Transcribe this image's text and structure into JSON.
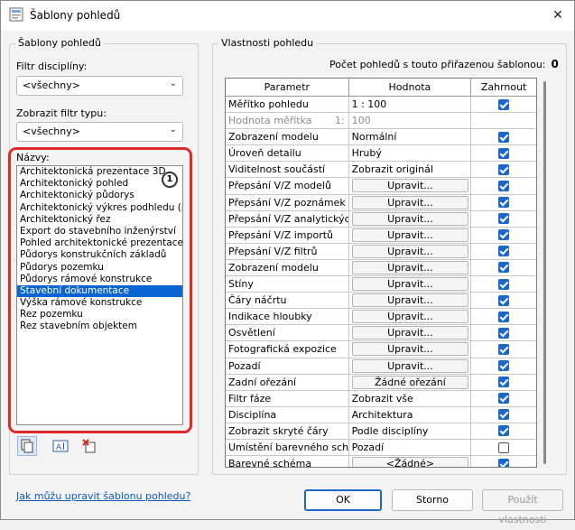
{
  "window": {
    "title": "Šablony pohledů"
  },
  "left_group": {
    "title": "Šablony pohledů",
    "discipline_filter": {
      "label": "Filtr disciplíny:",
      "value": "<všechny>"
    },
    "type_filter": {
      "label": "Zobrazit filtr typu:",
      "value": "<všechny>"
    },
    "names_label": "Názvy:",
    "callout": "1",
    "names": [
      "Architektonická prezentace 3D",
      "Architektonický pohled",
      "Architektonický půdorys",
      "Architektonický výkres podhledu (promítnutý)",
      "Architektonický řez",
      "Export do stavebního inženýrství",
      "Pohled architektonické prezentace",
      "Půdorys konstrukčních základů",
      "Půdorys pozemku",
      "Půdorys rámové konstrukce",
      "Stavební dokumentace",
      "Výška rámové konstrukce",
      "Řez pozemku",
      "Řez stavebním objektem"
    ],
    "selected_index": 10
  },
  "right_group": {
    "title": "Vlastnosti pohledu",
    "count_label": "Počet pohledů s touto přiřazenou šablonou:",
    "count_value": "0",
    "headers": {
      "param": "Parametr",
      "value": "Hodnota",
      "include": "Zahrnout"
    },
    "rows": [
      {
        "param": "Měřítko pohledu",
        "value": "1 : 100",
        "kind": "text",
        "include": true
      },
      {
        "param": "Hodnota měřítka",
        "scale_prefix": "1:",
        "value": "100",
        "kind": "text",
        "include": null,
        "dim": true
      },
      {
        "param": "Zobrazení modelu",
        "value": "Normální",
        "kind": "text",
        "include": true
      },
      {
        "param": "Úroveň detailu",
        "value": "Hrubý",
        "kind": "text",
        "include": true
      },
      {
        "param": "Viditelnost součástí",
        "value": "Zobrazit originál",
        "kind": "text",
        "include": true
      },
      {
        "param": "Přepsání V/Z modelů",
        "value": "Upravit...",
        "kind": "button",
        "include": true
      },
      {
        "param": "Přepsání V/Z poznámek",
        "value": "Upravit...",
        "kind": "button",
        "include": true
      },
      {
        "param": "Přepsání V/Z analytických",
        "value": "Upravit...",
        "kind": "button",
        "include": true
      },
      {
        "param": "Přepsání V/Z importů",
        "value": "Upravit...",
        "kind": "button",
        "include": true
      },
      {
        "param": "Přepsání V/Z filtrů",
        "value": "Upravit...",
        "kind": "button",
        "include": true
      },
      {
        "param": "Zobrazení modelu",
        "value": "Upravit...",
        "kind": "button",
        "include": true
      },
      {
        "param": "Stíny",
        "value": "Upravit...",
        "kind": "button",
        "include": true
      },
      {
        "param": "Čáry náčrtu",
        "value": "Upravit...",
        "kind": "button",
        "include": true
      },
      {
        "param": "Indikace hloubky",
        "value": "Upravit...",
        "kind": "button",
        "include": true
      },
      {
        "param": "Osvětlení",
        "value": "Upravit...",
        "kind": "button",
        "include": true
      },
      {
        "param": "Fotografická expozice",
        "value": "Upravit...",
        "kind": "button",
        "include": true
      },
      {
        "param": "Pozadí",
        "value": "Upravit...",
        "kind": "button",
        "include": true
      },
      {
        "param": "Zadní ořezání",
        "value": "Žádné ořezání",
        "kind": "button",
        "include": true
      },
      {
        "param": "Filtr fáze",
        "value": "Zobrazit vše",
        "kind": "text",
        "include": true
      },
      {
        "param": "Disciplína",
        "value": "Architektura",
        "kind": "text",
        "include": true
      },
      {
        "param": "Zobrazit skryté čáry",
        "value": "Podle disciplíny",
        "kind": "text",
        "include": true
      },
      {
        "param": "Umístění barevného schématu",
        "value": "Pozadí",
        "kind": "text",
        "include": false
      },
      {
        "param": "Barevné schéma",
        "value": "<Žádné>",
        "kind": "button",
        "include": true
      }
    ]
  },
  "footer": {
    "help_link": "Jak můžu upravit šablonu pohledu?",
    "ok": "OK",
    "cancel": "Storno",
    "apply": "Použít vlastnosti"
  },
  "colors": {
    "accent": "#1a66cc",
    "highlight": "#e02a2a",
    "selection": "#0a64d2"
  }
}
